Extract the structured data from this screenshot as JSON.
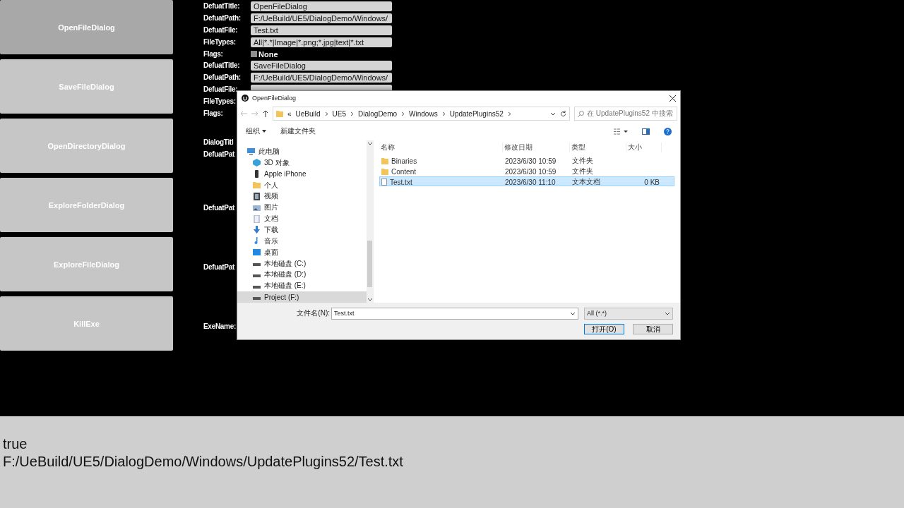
{
  "buttons": [
    {
      "label": "OpenFileDialog",
      "active": true
    },
    {
      "label": "SaveFileDialog",
      "active": false
    },
    {
      "label": "OpenDirectoryDialog",
      "active": false
    },
    {
      "label": "ExploreFolderDialog",
      "active": false
    },
    {
      "label": "ExploreFileDialog",
      "active": false
    },
    {
      "label": "KillExe",
      "active": false
    }
  ],
  "sections": [
    {
      "rows": [
        {
          "label": "DefuatTitle:",
          "kind": "field",
          "value": "OpenFileDialog"
        },
        {
          "label": "DefuatPath:",
          "kind": "field",
          "value": "F:/UeBuild/UE5/DialogDemo/Windows/"
        },
        {
          "label": "DefuatFile:",
          "kind": "field",
          "value": "Test.txt"
        },
        {
          "label": "FileTypes:",
          "kind": "field",
          "value": "All|*.*|Image|*.png;*.jpg|text|*.txt"
        },
        {
          "label": "Flags:",
          "kind": "checkbox",
          "value": "None",
          "checked": false
        }
      ]
    },
    {
      "rows": [
        {
          "label": "DefuatTitle:",
          "kind": "field",
          "value": "SaveFileDialog"
        },
        {
          "label": "DefuatPath:",
          "kind": "field",
          "value": "F:/UeBuild/UE5/DialogDemo/Windows/"
        },
        {
          "label": "DefuatFile:",
          "kind": "field"
        },
        {
          "label": "FileTypes:",
          "kind": "label"
        },
        {
          "label": "Flags:",
          "kind": "label"
        }
      ]
    },
    {
      "rows": [
        {
          "label": "DialogTitl",
          "kind": "label"
        },
        {
          "label": "DefuatPat",
          "kind": "label"
        }
      ]
    },
    {
      "rows": [
        {
          "label": "DefuatPat",
          "kind": "label"
        }
      ]
    },
    {
      "rows": [
        {
          "label": "DefuatPat",
          "kind": "label"
        }
      ]
    },
    {
      "rows": [
        {
          "label": "ExeName:",
          "kind": "label"
        }
      ]
    }
  ],
  "dialog": {
    "title": "OpenFileDialog",
    "breadcrumb_overflow": "«",
    "breadcrumb": [
      "UeBuild",
      "UE5",
      "DialogDemo",
      "Windows",
      "UpdatePlugins52"
    ],
    "search_placeholder": "在 UpdatePlugins52 中搜索",
    "toolbar": [
      "组织",
      "新建文件夹"
    ],
    "nav": [
      {
        "label": "此电脑",
        "kind": "pc",
        "selected": false,
        "children": [
          {
            "label": "3D 对象",
            "kind": "cube",
            "selected": false
          },
          {
            "label": "Apple iPhone",
            "kind": "phone",
            "selected": false
          },
          {
            "label": "个人",
            "kind": "folder",
            "selected": false
          },
          {
            "label": "视频",
            "kind": "video",
            "selected": false
          },
          {
            "label": "图片",
            "kind": "image",
            "selected": false
          },
          {
            "label": "文档",
            "kind": "doc",
            "selected": false
          },
          {
            "label": "下载",
            "kind": "download",
            "selected": false
          },
          {
            "label": "音乐",
            "kind": "music",
            "selected": false
          },
          {
            "label": "桌面",
            "kind": "desktop",
            "selected": false
          },
          {
            "label": "本地磁盘 (C:)",
            "kind": "drive",
            "selected": false
          },
          {
            "label": "本地磁盘 (D:)",
            "kind": "drive",
            "selected": false
          },
          {
            "label": "本地磁盘 (E:)",
            "kind": "drive",
            "selected": false
          },
          {
            "label": "Project (F:)",
            "kind": "drive",
            "selected": true
          }
        ]
      }
    ],
    "columns": [
      "名称",
      "修改日期",
      "类型",
      "大小"
    ],
    "files": [
      {
        "name": "Binaries",
        "kind": "folder",
        "date": "2023/6/30 10:59",
        "type": "文件夹",
        "selected": false
      },
      {
        "name": "Content",
        "kind": "folder",
        "date": "2023/6/30 10:59",
        "type": "文件夹",
        "selected": false
      },
      {
        "name": "Test.txt",
        "kind": "file",
        "date": "2023/6/30 11:10",
        "type": "文本文档",
        "size": "0 KB",
        "selected": true
      }
    ],
    "filename_label": "文件名(N):",
    "filename": "Test.txt",
    "filter": "All (*.*)",
    "open_button": "打开(O)",
    "cancel_button": "取消"
  },
  "output": [
    "true",
    "F:/UeBuild/UE5/DialogDemo/Windows/UpdatePlugins52/Test.txt"
  ]
}
